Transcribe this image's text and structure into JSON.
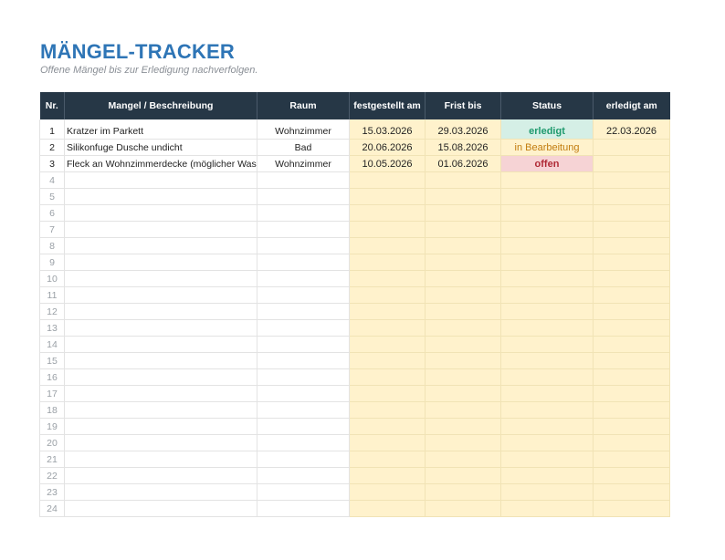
{
  "title": "MÄNGEL-TRACKER",
  "subtitle": "Offene Mängel bis zur Erledigung nachverfolgen.",
  "columns": [
    "Nr.",
    "Mangel / Beschreibung",
    "Raum",
    "festgestellt am",
    "Frist bis",
    "Status",
    "erledigt am"
  ],
  "rows": [
    {
      "nr": "1",
      "desc": "Kratzer im Parkett",
      "room": "Wohnzimmer",
      "found": "15.03.2026",
      "deadline": "29.03.2026",
      "status": "erledigt",
      "status_key": "erledigt",
      "done": "22.03.2026"
    },
    {
      "nr": "2",
      "desc": "Silikonfuge Dusche undicht",
      "room": "Bad",
      "found": "20.06.2026",
      "deadline": "15.08.2026",
      "status": "in Bearbeitung",
      "status_key": "bearbeitung",
      "done": ""
    },
    {
      "nr": "3",
      "desc": "Fleck an Wohnzimmerdecke (möglicher Wasserschaden)",
      "room": "Wohnzimmer",
      "found": "10.05.2026",
      "deadline": "01.06.2026",
      "status": "offen",
      "status_key": "offen",
      "done": ""
    },
    {
      "nr": "4",
      "desc": "",
      "room": "",
      "found": "",
      "deadline": "",
      "status": "",
      "status_key": "",
      "done": ""
    },
    {
      "nr": "5",
      "desc": "",
      "room": "",
      "found": "",
      "deadline": "",
      "status": "",
      "status_key": "",
      "done": ""
    },
    {
      "nr": "6",
      "desc": "",
      "room": "",
      "found": "",
      "deadline": "",
      "status": "",
      "status_key": "",
      "done": ""
    },
    {
      "nr": "7",
      "desc": "",
      "room": "",
      "found": "",
      "deadline": "",
      "status": "",
      "status_key": "",
      "done": ""
    },
    {
      "nr": "8",
      "desc": "",
      "room": "",
      "found": "",
      "deadline": "",
      "status": "",
      "status_key": "",
      "done": ""
    },
    {
      "nr": "9",
      "desc": "",
      "room": "",
      "found": "",
      "deadline": "",
      "status": "",
      "status_key": "",
      "done": ""
    },
    {
      "nr": "10",
      "desc": "",
      "room": "",
      "found": "",
      "deadline": "",
      "status": "",
      "status_key": "",
      "done": ""
    },
    {
      "nr": "11",
      "desc": "",
      "room": "",
      "found": "",
      "deadline": "",
      "status": "",
      "status_key": "",
      "done": ""
    },
    {
      "nr": "12",
      "desc": "",
      "room": "",
      "found": "",
      "deadline": "",
      "status": "",
      "status_key": "",
      "done": ""
    },
    {
      "nr": "13",
      "desc": "",
      "room": "",
      "found": "",
      "deadline": "",
      "status": "",
      "status_key": "",
      "done": ""
    },
    {
      "nr": "14",
      "desc": "",
      "room": "",
      "found": "",
      "deadline": "",
      "status": "",
      "status_key": "",
      "done": ""
    },
    {
      "nr": "15",
      "desc": "",
      "room": "",
      "found": "",
      "deadline": "",
      "status": "",
      "status_key": "",
      "done": ""
    },
    {
      "nr": "16",
      "desc": "",
      "room": "",
      "found": "",
      "deadline": "",
      "status": "",
      "status_key": "",
      "done": ""
    },
    {
      "nr": "17",
      "desc": "",
      "room": "",
      "found": "",
      "deadline": "",
      "status": "",
      "status_key": "",
      "done": ""
    },
    {
      "nr": "18",
      "desc": "",
      "room": "",
      "found": "",
      "deadline": "",
      "status": "",
      "status_key": "",
      "done": ""
    },
    {
      "nr": "19",
      "desc": "",
      "room": "",
      "found": "",
      "deadline": "",
      "status": "",
      "status_key": "",
      "done": ""
    },
    {
      "nr": "20",
      "desc": "",
      "room": "",
      "found": "",
      "deadline": "",
      "status": "",
      "status_key": "",
      "done": ""
    },
    {
      "nr": "21",
      "desc": "",
      "room": "",
      "found": "",
      "deadline": "",
      "status": "",
      "status_key": "",
      "done": ""
    },
    {
      "nr": "22",
      "desc": "",
      "room": "",
      "found": "",
      "deadline": "",
      "status": "",
      "status_key": "",
      "done": ""
    },
    {
      "nr": "23",
      "desc": "",
      "room": "",
      "found": "",
      "deadline": "",
      "status": "",
      "status_key": "",
      "done": ""
    },
    {
      "nr": "24",
      "desc": "",
      "room": "",
      "found": "",
      "deadline": "",
      "status": "",
      "status_key": "",
      "done": ""
    }
  ],
  "colors": {
    "title": "#2e75b6",
    "header_bg": "#263746",
    "date_fill": "#fff2cc",
    "status_erledigt_bg": "#d5efe6",
    "status_erledigt_fg": "#1f9a6e",
    "status_bearbeitung_fg": "#c27c0e",
    "status_offen_bg": "#f6d3d5",
    "status_offen_fg": "#b02a36"
  }
}
